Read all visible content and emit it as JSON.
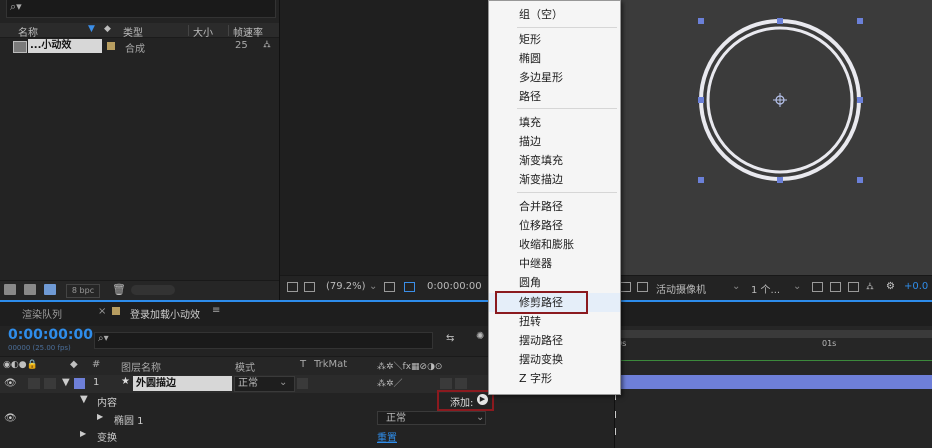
{
  "project": {
    "search_icon": "search-icon",
    "columns": [
      "名称",
      "类型",
      "大小",
      "帧速率"
    ],
    "row": {
      "name": "...小动效",
      "type": "合成",
      "size": "",
      "fps": "25"
    },
    "footer_bpc": "8 bpc"
  },
  "viewer": {
    "zoom": "(79.2%)",
    "timecode": "0:00:00:00",
    "camera": "活动摄像机",
    "views": "1 个...",
    "exposure": "+0.0"
  },
  "timeline": {
    "tab_render": "渲染队列",
    "tab_comp": "登录加载小动效",
    "timecode": "0:00:00:00",
    "frames": "00000 (25.00 fps)",
    "columns": {
      "num": "#",
      "layer_name": "图层名称",
      "mode": "模式",
      "t": "T",
      "trkmat": "TrkMat"
    },
    "layer": {
      "index": "1",
      "name": "外圆描边",
      "mode": "正常"
    },
    "contents_label": "内容",
    "add_label": "添加:",
    "ellipse_label": "椭圆 1",
    "ellipse_mode": "正常",
    "transform_label": "变换",
    "reset_label": "重置",
    "ruler": {
      "start": "0s",
      "mark": "01s"
    }
  },
  "menu": {
    "items": [
      [
        "组（空）"
      ],
      [
        "矩形",
        "椭圆",
        "多边星形",
        "路径"
      ],
      [
        "填充",
        "描边",
        "渐变填充",
        "渐变描边"
      ],
      [
        "合并路径",
        "位移路径",
        "收缩和膨胀",
        "中继器",
        "圆角",
        "修剪路径",
        "扭转",
        "摆动路径",
        "摆动变换",
        "Z 字形"
      ]
    ],
    "highlighted": "修剪路径"
  },
  "colors": {
    "accent": "#2d8ceb",
    "highlight_box": "#8b1a1f",
    "layer_bar": "#6e7fd8"
  }
}
